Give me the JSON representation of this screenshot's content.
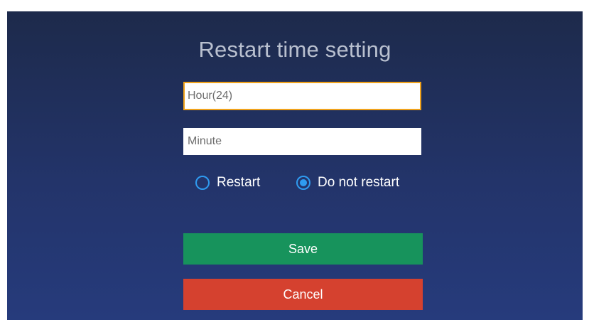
{
  "dialog": {
    "title": "Restart time setting",
    "hour": {
      "value": "",
      "placeholder": "Hour(24)"
    },
    "minute": {
      "value": "",
      "placeholder": "Minute"
    },
    "options": [
      {
        "label": "Restart",
        "checked": false
      },
      {
        "label": "Do not restart",
        "checked": true
      }
    ],
    "save_label": "Save",
    "cancel_label": "Cancel"
  },
  "colors": {
    "background_top": "#1d2a4b",
    "background_bottom": "#263b7c",
    "focus_border": "#f0a21b",
    "radio_accent": "#2f9bf0",
    "save_button": "#17935c",
    "cancel_button": "#d5412f"
  }
}
